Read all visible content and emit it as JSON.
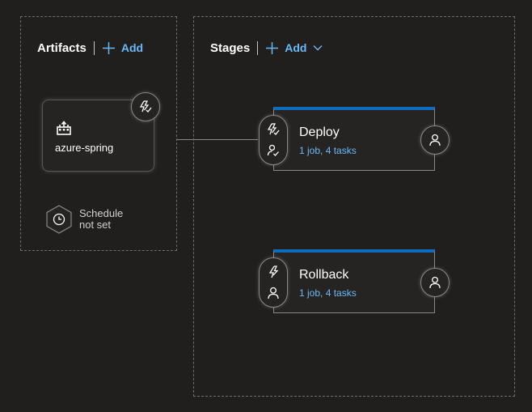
{
  "artifacts": {
    "title": "Artifacts",
    "add_label": "Add",
    "items": [
      {
        "name": "azure-spring",
        "icon": "build-icon"
      }
    ],
    "schedule": {
      "line1": "Schedule",
      "line2": "not set"
    }
  },
  "stages": {
    "title": "Stages",
    "add_label": "Add",
    "items": [
      {
        "name": "Deploy",
        "summary": "1 job, 4 tasks"
      },
      {
        "name": "Rollback",
        "summary": "1 job, 4 tasks"
      }
    ]
  },
  "colors": {
    "background": "#201f1e",
    "accent": "#0f6cbd",
    "link": "#6cb8f6"
  }
}
